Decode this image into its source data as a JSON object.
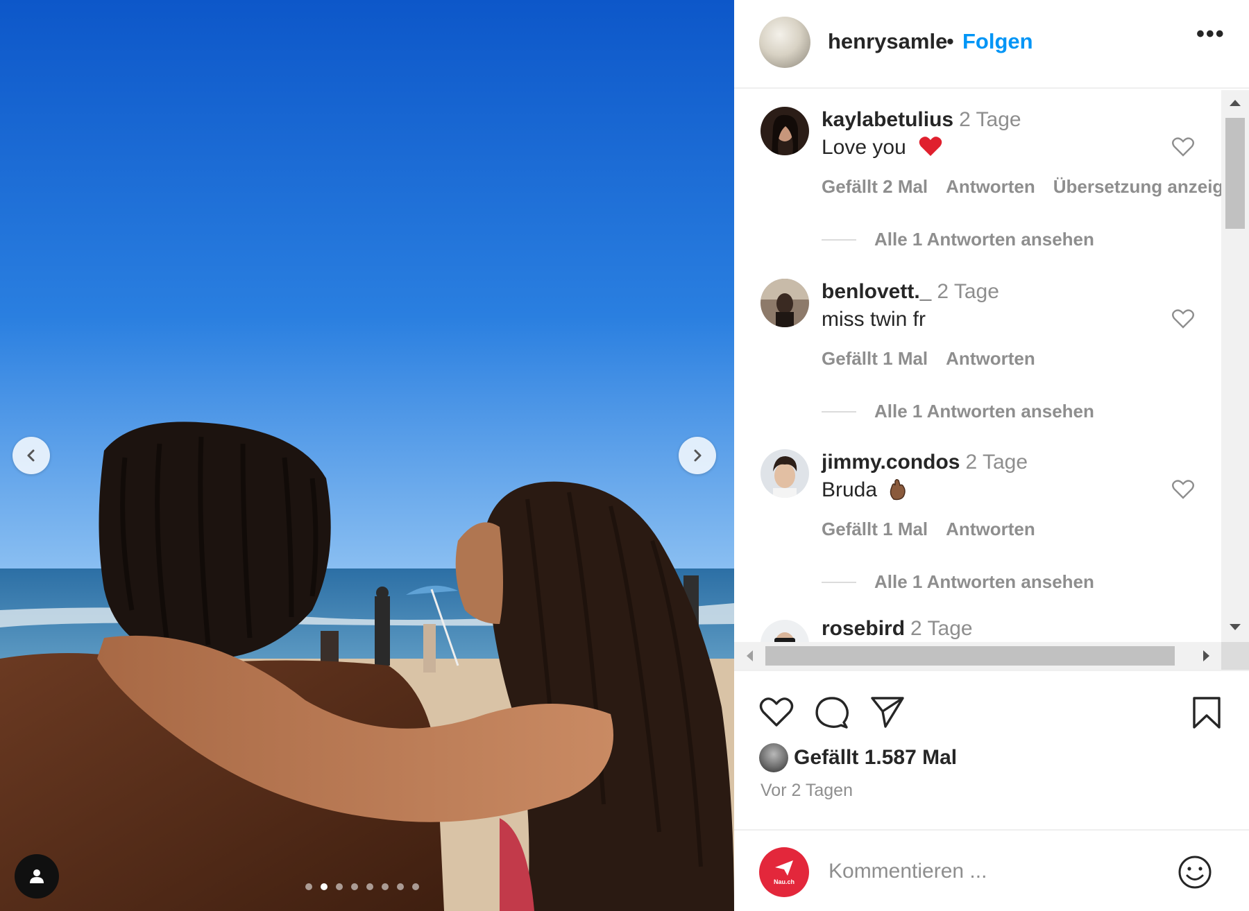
{
  "post": {
    "username": "henrysamle",
    "separator": "•",
    "follow_label": "Folgen",
    "more_label": "•••"
  },
  "photo": {
    "dot_count": 8,
    "active_dot": 1
  },
  "comments": [
    {
      "username": "kaylabetulius",
      "age": "2 Tage",
      "text": "Love you",
      "emoji": "heart",
      "likes": "Gefällt 2 Mal",
      "reply": "Antworten",
      "translate": "Übersetzung anzeig",
      "view_replies": "Alle 1 Antworten ansehen"
    },
    {
      "username": "benlovett._",
      "age": "2 Tage",
      "text": "miss twin fr",
      "likes": "Gefällt 1 Mal",
      "reply": "Antworten",
      "view_replies": "Alle 1 Antworten ansehen"
    },
    {
      "username": "jimmy.condos",
      "age": "2 Tage",
      "text": "Bruda",
      "emoji": "crossed-fingers",
      "likes": "Gefällt 1 Mal",
      "reply": "Antworten",
      "view_replies": "Alle 1 Antworten ansehen"
    },
    {
      "username": "rosebird",
      "age": "2 Tage"
    }
  ],
  "stats": {
    "likes_text": "Gefällt 1.587 Mal",
    "time_ago": "Vor 2 Tagen"
  },
  "composer": {
    "placeholder": "Kommentieren ...",
    "badge_label": "Nau.ch"
  },
  "colors": {
    "accent": "#0095f6",
    "muted": "#8e8e8e",
    "badge": "#e3273b"
  }
}
